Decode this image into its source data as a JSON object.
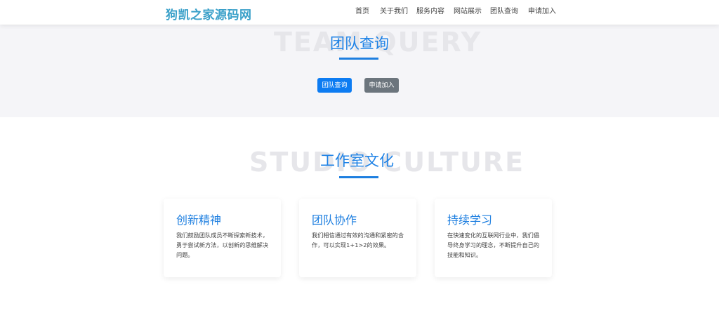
{
  "brand": {
    "logo_text": "狗凯之家源码网"
  },
  "nav": {
    "items": [
      {
        "label": "首页"
      },
      {
        "label": "关于我们"
      },
      {
        "label": "服务内容"
      },
      {
        "label": "网站展示"
      },
      {
        "label": "团队查询"
      },
      {
        "label": "申请加入"
      }
    ]
  },
  "hero": {
    "watermark": "TEAM QUERY",
    "title": "团队查询",
    "buttons": {
      "primary_label": "团队查询",
      "secondary_label": "申请加入"
    }
  },
  "culture": {
    "watermark": "STUDIO CULTURE",
    "title": "工作室文化",
    "cards": [
      {
        "title": "创新精神",
        "text": "我们鼓励团队成员不断探索新技术，勇于尝试新方法，以创新的思维解决问题。"
      },
      {
        "title": "团队协作",
        "text": "我们相信通过有效的沟通和紧密的合作，可以实现1+1>2的效果。"
      },
      {
        "title": "持续学习",
        "text": "在快速变化的互联网行业中，我们倡导终身学习的理念，不断提升自己的技能和知识。"
      }
    ]
  },
  "colors": {
    "accent": "#1e82e6",
    "primary_button": "#0d7cf2",
    "secondary_button": "#6c757d",
    "hero_background": "#f5f5f8"
  }
}
